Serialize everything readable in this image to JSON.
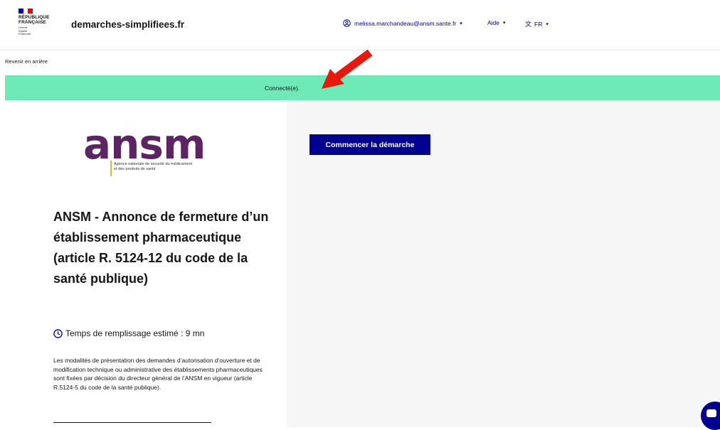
{
  "header": {
    "logo": {
      "republique_line1": "RÉPUBLIQUE",
      "republique_line2": "FRANÇAISE",
      "devise": [
        "Liberté",
        "Égalité",
        "Fraternité"
      ],
      "flag_colors": [
        "#000091",
        "#ffffff",
        "#e1000f"
      ]
    },
    "site_name": "demarches-simplifiees.fr",
    "user_menu": {
      "icon": "user-circle-icon",
      "email": "melissa.marchandeau@ansm.sante.fr"
    },
    "help_menu": {
      "label": "Aide"
    },
    "lang_menu": {
      "icon": "translate-icon",
      "label": "FR"
    }
  },
  "back_link": "Revenir en arrière",
  "flash": {
    "text": "Connecté(e).",
    "color": "#6ee9b8"
  },
  "procedure": {
    "logo": {
      "word": "ansm",
      "tagline_line1": "Agence nationale de sécurité du médicament",
      "tagline_line2": "et des produits de santé",
      "color": "#5e2364",
      "accent": "#b8cc2a"
    },
    "title": "ANSM - Annonce de fermeture d’un établissement pharmaceutique (article R. 5124-12 du code de la santé publique)",
    "duration": "Temps de remplissage estimé : 9 mn",
    "description": "Les modalités de présentation des demandes d’autorisation d’ouverture et de modification technique ou administrative des établissements pharmaceutiques sont fixées par décision du directeur général de l’ANSM en vigueur (article R.5124-5 du code de la santé publique)."
  },
  "start_button": {
    "label": "Commencer la démarche",
    "color": "#000091"
  },
  "annotation": {
    "color": "#e8190c"
  },
  "chat": {
    "icon": "chat-icon"
  }
}
